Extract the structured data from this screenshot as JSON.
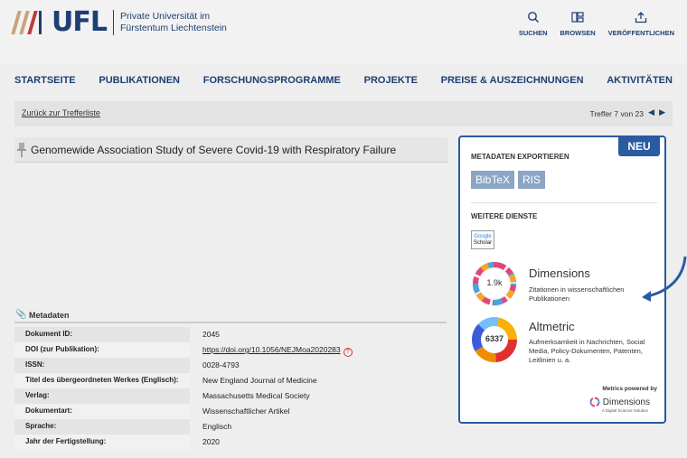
{
  "header": {
    "logo_text": "UFL",
    "university_line1": "Private Universität im",
    "university_line2": "Fürstentum Liechtenstein",
    "slash_colors": [
      "#c9a27c",
      "#c9a27c",
      "#c03a3a",
      "#1d3f73"
    ],
    "icons": [
      {
        "label": "SUCHEN",
        "icon": "search-icon"
      },
      {
        "label": "BROWSEN",
        "icon": "browse-icon"
      },
      {
        "label": "VERÖFFENTLICHEN",
        "icon": "upload-icon"
      }
    ]
  },
  "nav": {
    "items": [
      "STARTSEITE",
      "PUBLIKATIONEN",
      "FORSCHUNGSPROGRAMME",
      "PROJEKTE",
      "PREISE & AUSZEICHNUNGEN",
      "AKTIVITÄTEN"
    ]
  },
  "resultbar": {
    "back_label": "Zurück zur Trefferliste",
    "hits_label": "Treffer 7 von 23",
    "prev_arrow": "◀",
    "next_arrow": "▶"
  },
  "document": {
    "title": "Genomewide Association Study of Severe Covid-19 with Respiratory Failure"
  },
  "metadata": {
    "heading": "Metadaten",
    "rows": [
      {
        "key": "Dokument ID:",
        "value": "2045"
      },
      {
        "key": "DOI (zur Publikation):",
        "value": "https://doi.org/10.1056/NEJMoa2020283"
      },
      {
        "key": "ISSN:",
        "value": "0028-4793"
      },
      {
        "key": "Titel des übergeordneten Werkes (Englisch):",
        "value": "New England Journal of Medicine"
      },
      {
        "key": "Verlag:",
        "value": "Massachusetts Medical Society"
      },
      {
        "key": "Dokumentart:",
        "value": "Wissenschaftlicher Artikel"
      },
      {
        "key": "Sprache:",
        "value": "Englisch"
      },
      {
        "key": "Jahr der Fertigstellung:",
        "value": "2020"
      }
    ]
  },
  "panel": {
    "new_badge": "NEU",
    "export_heading": "METADATEN EXPORTIEREN",
    "export_buttons": [
      "BibTeX",
      "RIS"
    ],
    "services_heading": "WEITERE DIENSTE",
    "scholar_line1": "Google",
    "scholar_line2": "Scholar",
    "dimensions": {
      "title": "Dimensions",
      "count": "1.9k",
      "desc": "Zitationen in wissenschaftlichen Publikationen"
    },
    "altmetric": {
      "title": "Altmetric",
      "score": "6337",
      "desc": "Aufmerksamkeit in Nachrichten, Social Media, Policy-Dokumenten, Patenten, Leitlinien u. a."
    },
    "powered_by": "Metrics powered by",
    "dim_logo_text": "Dimensions",
    "dim_logo_sub": "A Digital Science Solution"
  },
  "colors": {
    "brand": "#1d3f73",
    "panel_border": "#2a5aa0",
    "badge": "#8ba5c5"
  }
}
